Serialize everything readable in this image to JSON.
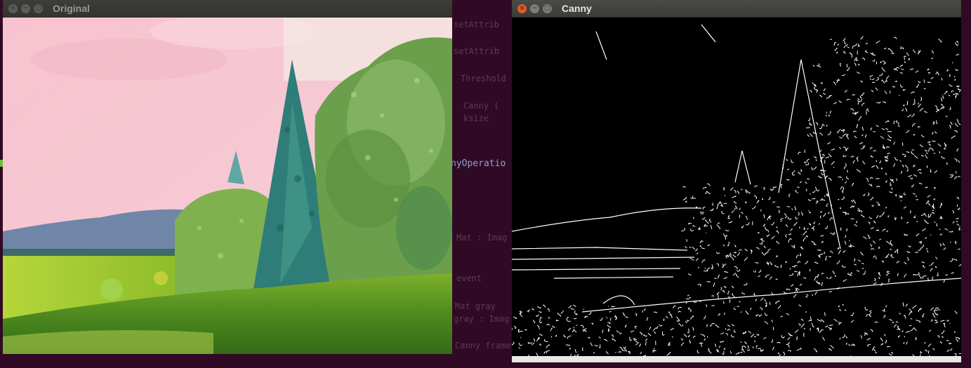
{
  "background_terminal": {
    "lines": [
      {
        "text": "setAttrib"
      },
      {
        "text": "setAttrib"
      },
      {
        "text": "Threshold"
      },
      {
        "text": "Canny ("
      },
      {
        "text": "ksize"
      },
      {
        "text": "nyOperatio"
      },
      {
        "text": "Mat : Imag"
      },
      {
        "text": "event"
      },
      {
        "text": "Mat gray"
      },
      {
        "text": "gray : Imag"
      },
      {
        "text": "Canny frame"
      }
    ]
  },
  "windows": [
    {
      "title": "Original",
      "state": "inactive"
    },
    {
      "title": "Canny",
      "state": "active"
    }
  ],
  "controls": {
    "close": "×",
    "minimize": "−",
    "maximize": "□"
  },
  "colors": {
    "terminal_bg": "#300a24",
    "close_active": "#e25a2c",
    "titlebar": "#3c3b37"
  }
}
